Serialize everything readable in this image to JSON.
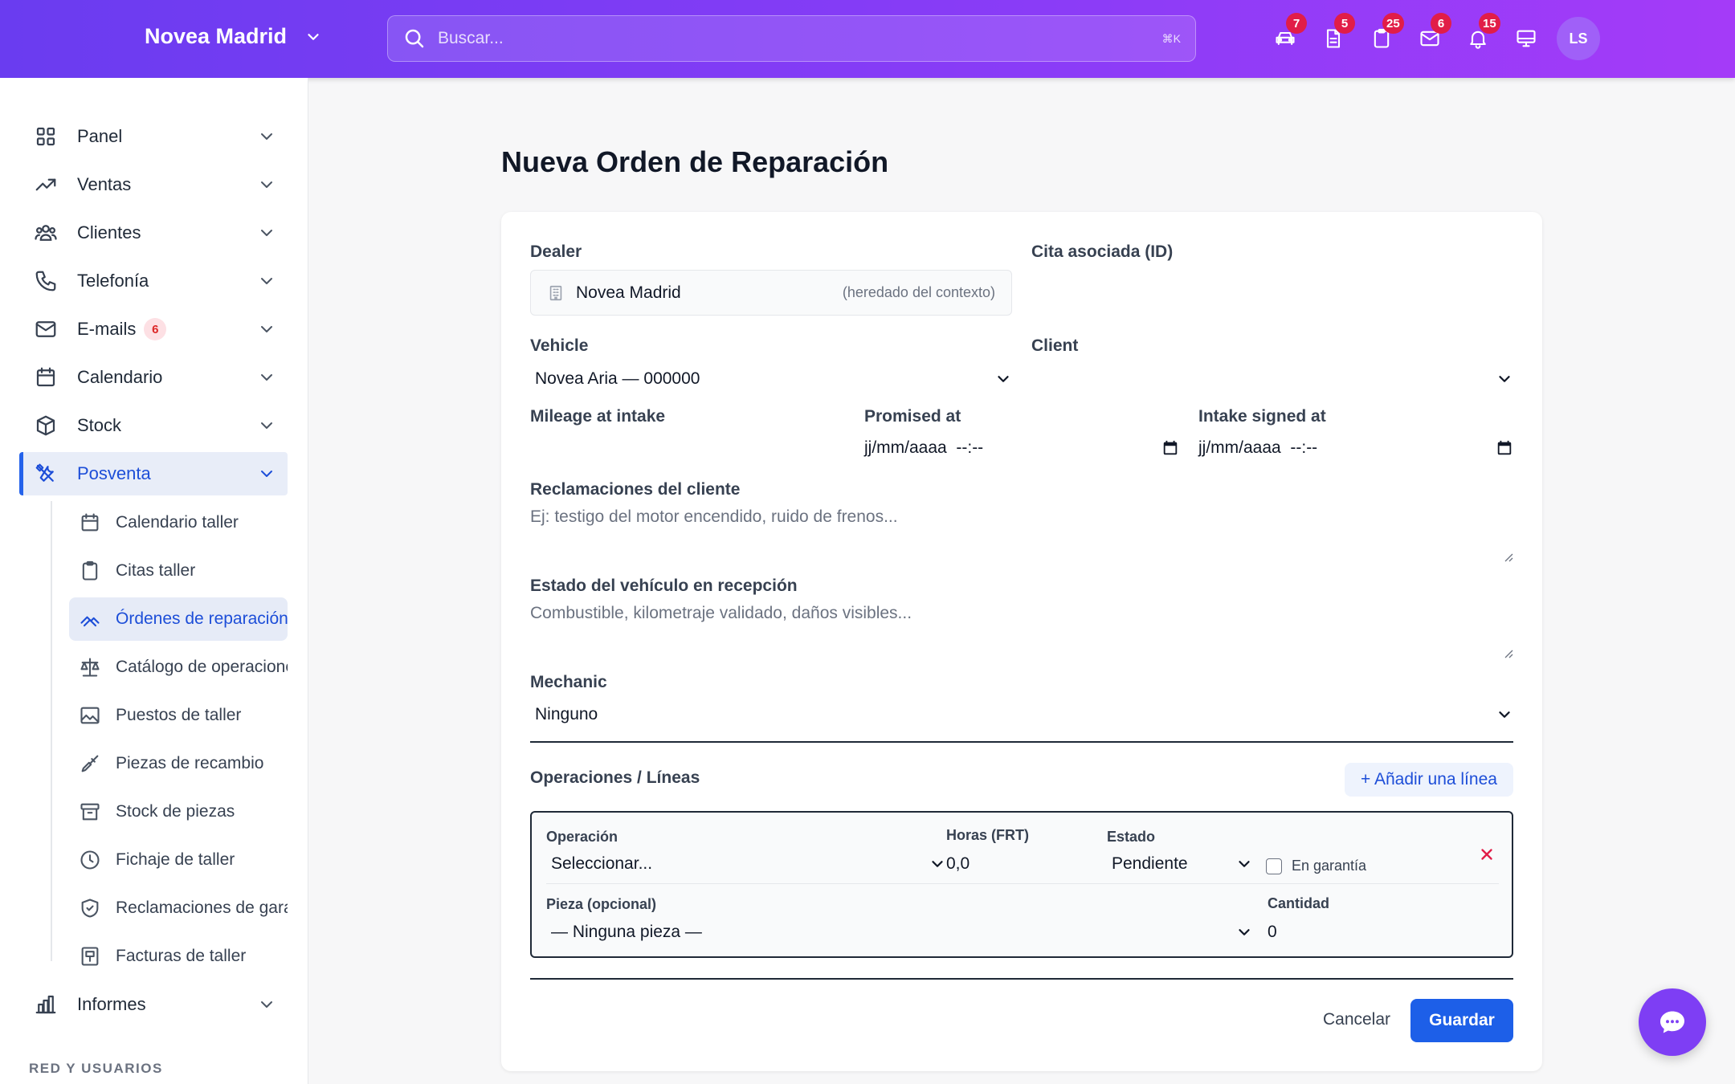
{
  "header": {
    "brand": "Novea Madrid",
    "search_placeholder": "Buscar...",
    "search_shortcut": "⌘K",
    "icons": [
      {
        "name": "car-icon",
        "badge": "7"
      },
      {
        "name": "document-icon",
        "badge": "5"
      },
      {
        "name": "clipboard-icon",
        "badge": "25"
      },
      {
        "name": "mail-icon",
        "badge": "6"
      },
      {
        "name": "bell-icon",
        "badge": "15"
      },
      {
        "name": "monitor-icon",
        "badge": ""
      }
    ],
    "avatar_initials": "LS"
  },
  "sidebar": {
    "items": [
      {
        "label": "Panel",
        "icon": "grid-icon"
      },
      {
        "label": "Ventas",
        "icon": "trending-up-icon"
      },
      {
        "label": "Clientes",
        "icon": "users-icon"
      },
      {
        "label": "Telefonía",
        "icon": "phone-icon"
      },
      {
        "label": "E-mails",
        "icon": "mail-icon",
        "badge": "6"
      },
      {
        "label": "Calendario",
        "icon": "calendar-icon"
      },
      {
        "label": "Stock",
        "icon": "box-icon"
      },
      {
        "label": "Posventa",
        "icon": "tools-icon"
      },
      {
        "label": "Informes",
        "icon": "chart-icon"
      }
    ],
    "sub_items": [
      {
        "label": "Calendario taller",
        "icon": "calendar-icon"
      },
      {
        "label": "Citas taller",
        "icon": "clipboard-icon"
      },
      {
        "label": "Órdenes de reparación",
        "icon": "wrench-icon"
      },
      {
        "label": "Catálogo de operaciones",
        "icon": "scale-icon"
      },
      {
        "label": "Puestos de taller",
        "icon": "image-icon"
      },
      {
        "label": "Piezas de recambio",
        "icon": "screwdriver-icon"
      },
      {
        "label": "Stock de piezas",
        "icon": "archive-icon"
      },
      {
        "label": "Fichaje de taller",
        "icon": "clock-icon"
      },
      {
        "label": "Reclamaciones de garantía",
        "icon": "shield-icon"
      },
      {
        "label": "Facturas de taller",
        "icon": "invoice-icon"
      }
    ],
    "section_label": "RED Y USUARIOS"
  },
  "form": {
    "title": "Nueva Orden de Reparación",
    "dealer_label": "Dealer",
    "dealer_value": "Novea Madrid",
    "dealer_hint": "(heredado del contexto)",
    "cita_label": "Cita asociada (ID)",
    "vehicle_label": "Vehicle",
    "vehicle_value": "Novea Aria — 000000",
    "client_label": "Client",
    "client_value": "",
    "mileage_label": "Mileage at intake",
    "promised_label": "Promised at",
    "promised_value": "jj/mm/aaaa  --:--",
    "intake_label": "Intake signed at",
    "intake_value": "jj/mm/aaaa  --:--",
    "claims_label": "Reclamaciones del cliente",
    "claims_placeholder": "Ej: testigo del motor encendido, ruido de frenos...",
    "state_label": "Estado del vehículo en recepción",
    "state_placeholder": "Combustible, kilometraje validado, daños visibles...",
    "mechanic_label": "Mechanic",
    "mechanic_value": "Ninguno",
    "ops_title": "Operaciones / Líneas",
    "add_line": "+ Añadir una línea",
    "line": {
      "operation_label": "Operación",
      "operation_value": "Seleccionar...",
      "hours_label": "Horas (FRT)",
      "hours_value": "0,0",
      "status_label": "Estado",
      "status_value": "Pendiente",
      "warranty_label": "En garantía",
      "part_label": "Pieza (opcional)",
      "part_value": "— Ninguna pieza —",
      "qty_label": "Cantidad",
      "qty_value": "0"
    },
    "cancel": "Cancelar",
    "save": "Guardar"
  },
  "colors": {
    "header_gradient_start": "#6a3cf0",
    "header_gradient_end": "#a43bf8",
    "accent": "#1d5fe8",
    "badge": "#e11d48"
  }
}
